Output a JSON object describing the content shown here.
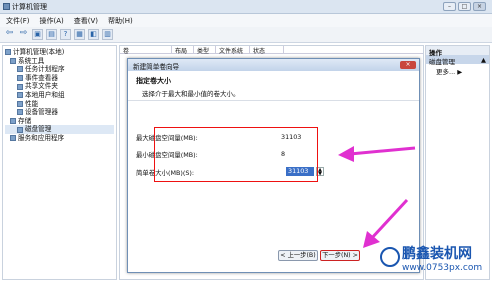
{
  "window": {
    "title": "计算机管理"
  },
  "menu": [
    "文件(F)",
    "操作(A)",
    "查看(V)",
    "帮助(H)"
  ],
  "tree": [
    {
      "label": "计算机管理(本地)",
      "indent": 0
    },
    {
      "label": "系统工具",
      "indent": 1
    },
    {
      "label": "任务计划程序",
      "indent": 2
    },
    {
      "label": "事件查看器",
      "indent": 2
    },
    {
      "label": "共享文件夹",
      "indent": 2
    },
    {
      "label": "本地用户和组",
      "indent": 2
    },
    {
      "label": "性能",
      "indent": 2
    },
    {
      "label": "设备管理器",
      "indent": 2
    },
    {
      "label": "存储",
      "indent": 1
    },
    {
      "label": "磁盘管理",
      "indent": 2,
      "selected": true
    },
    {
      "label": "服务和应用程序",
      "indent": 1
    }
  ],
  "columns": [
    "卷",
    "布局",
    "类型",
    "文件系统",
    "状态"
  ],
  "actions": {
    "header": "操作",
    "section": "磁盘管理",
    "more": "更多..."
  },
  "dialog": {
    "caption": "新建简单卷向导",
    "heading": "指定卷大小",
    "subheading": "选择介于最大和最小值的卷大小。",
    "fields": [
      {
        "label": "最大磁盘空间量(MB):",
        "value": "31103"
      },
      {
        "label": "最小磁盘空间量(MB):",
        "value": "8"
      },
      {
        "label": "简单卷大小(MB)(S):",
        "value": "31103"
      }
    ],
    "back": "< 上一步(B)",
    "next": "下一步(N) >"
  },
  "watermark": {
    "name": "鹏鑫装机网",
    "url": "www.0753px.com"
  }
}
